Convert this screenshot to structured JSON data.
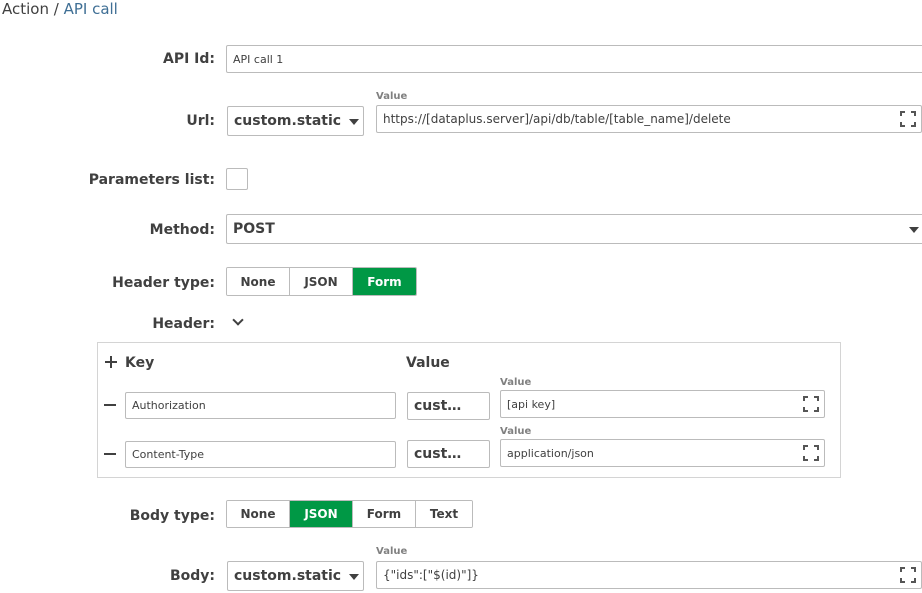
{
  "breadcrumb": {
    "parent": "Action",
    "separator": " / ",
    "current": "API call"
  },
  "api_id": {
    "label": "API Id:",
    "value": "API call 1"
  },
  "url": {
    "label": "Url:",
    "source": "custom.static",
    "value_label": "Value",
    "value": "https://[dataplus.server]/api/db/table/[table_name]/delete"
  },
  "parameters_list": {
    "label": "Parameters list:",
    "checked": false
  },
  "method": {
    "label": "Method:",
    "value": "POST"
  },
  "header_type": {
    "label": "Header type:",
    "options": [
      "None",
      "JSON",
      "Form"
    ],
    "selected": "Form"
  },
  "header": {
    "label": "Header:",
    "key_heading": "Key",
    "value_heading": "Value",
    "rows": [
      {
        "key": "Authorization",
        "source": "cust…",
        "value_label": "Value",
        "value": "[api key]"
      },
      {
        "key": "Content-Type",
        "source": "cust…",
        "value_label": "Value",
        "value": "application/json"
      }
    ]
  },
  "body_type": {
    "label": "Body type:",
    "options": [
      "None",
      "JSON",
      "Form",
      "Text"
    ],
    "selected": "JSON"
  },
  "body": {
    "label": "Body:",
    "source": "custom.static",
    "value_label": "Value",
    "value": "{\"ids\":[\"$(id)\"]}"
  },
  "colors": {
    "accent_green": "#009845",
    "breadcrumb_link": "#3f6f95"
  }
}
